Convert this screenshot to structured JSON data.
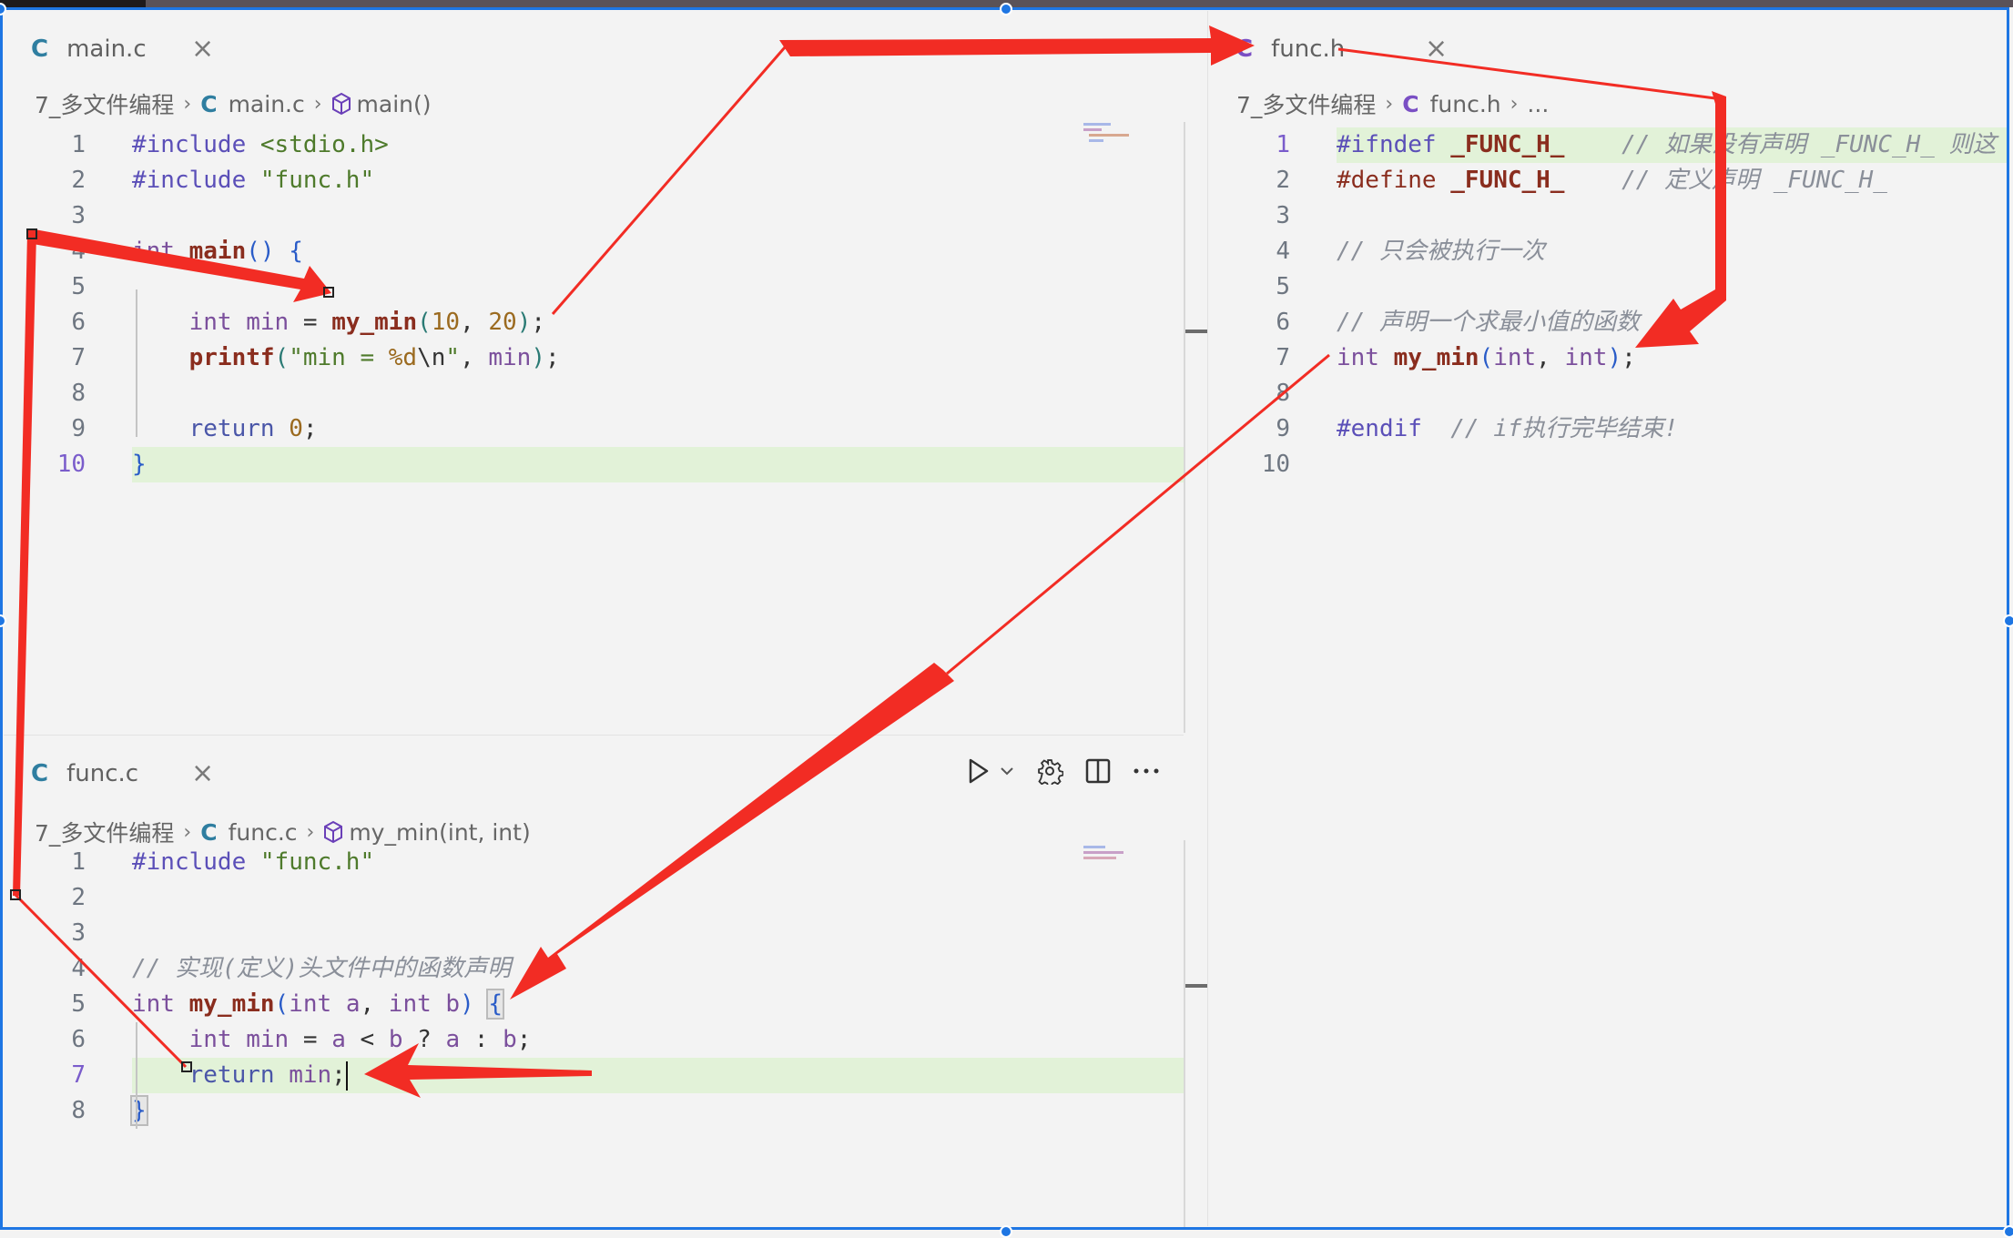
{
  "colors": {
    "accent": "#1e76e3",
    "annotation": "#f22c24",
    "c_icon_source": "#2f7ea0",
    "c_icon_header": "#7a4fc4",
    "line_highlight": "#e2f2d8"
  },
  "panes": {
    "main": {
      "tab": {
        "icon": "C",
        "label": "main.c",
        "close": "×"
      },
      "breadcrumb": {
        "folder": "7_多文件编程",
        "file_icon": "C",
        "file": "main.c",
        "symbol": "main()"
      },
      "lines": [
        {
          "n": "1",
          "text": "#include <stdio.h>"
        },
        {
          "n": "2",
          "text": "#include \"func.h\""
        },
        {
          "n": "3",
          "text": ""
        },
        {
          "n": "4",
          "text": "int main() {"
        },
        {
          "n": "5",
          "text": ""
        },
        {
          "n": "6",
          "text": "    int min = my_min(10, 20);"
        },
        {
          "n": "7",
          "text": "    printf(\"min = %d\\n\", min);"
        },
        {
          "n": "8",
          "text": ""
        },
        {
          "n": "9",
          "text": "    return 0;"
        },
        {
          "n": "10",
          "text": "}"
        }
      ],
      "active_line": "10"
    },
    "funcc": {
      "tab": {
        "icon": "C",
        "label": "func.c",
        "close": "×"
      },
      "breadcrumb": {
        "folder": "7_多文件编程",
        "file_icon": "C",
        "file": "func.c",
        "symbol": "my_min(int, int)"
      },
      "actions": [
        "run-icon",
        "run-dropdown-icon",
        "gear-icon",
        "split-editor-icon",
        "more-actions-icon"
      ],
      "lines": [
        {
          "n": "1",
          "text": "#include \"func.h\""
        },
        {
          "n": "2",
          "text": ""
        },
        {
          "n": "3",
          "text": ""
        },
        {
          "n": "4",
          "text": "// 实现(定义)头文件中的函数声明"
        },
        {
          "n": "5",
          "text": "int my_min(int a, int b) {"
        },
        {
          "n": "6",
          "text": "    int min = a < b ? a : b;"
        },
        {
          "n": "7",
          "text": "    return min;"
        },
        {
          "n": "8",
          "text": "}"
        }
      ],
      "active_line": "7"
    },
    "funch": {
      "tab": {
        "icon": "C",
        "label": "func.h",
        "close": "×"
      },
      "breadcrumb": {
        "folder": "7_多文件编程",
        "file_icon": "C",
        "file": "func.h",
        "symbol": "..."
      },
      "lines": [
        {
          "n": "1",
          "text": "#ifndef _FUNC_H_    // 如果没有声明 _FUNC_H_ 则这"
        },
        {
          "n": "2",
          "text": "#define _FUNC_H_    // 定义声明 _FUNC_H_"
        },
        {
          "n": "3",
          "text": ""
        },
        {
          "n": "4",
          "text": "// 只会被执行一次"
        },
        {
          "n": "5",
          "text": ""
        },
        {
          "n": "6",
          "text": "// 声明一个求最小值的函数"
        },
        {
          "n": "7",
          "text": "int my_min(int, int);"
        },
        {
          "n": "8",
          "text": ""
        },
        {
          "n": "9",
          "text": "#endif  // if执行完毕结束!"
        },
        {
          "n": "10",
          "text": ""
        }
      ],
      "active_line": "1"
    }
  },
  "tokens": {
    "main": {
      "l1": [
        [
          "#include",
          "pp"
        ],
        [
          " ",
          ""
        ],
        [
          "<stdio.h>",
          "str"
        ]
      ],
      "l2": [
        [
          "#include",
          "pp"
        ],
        [
          " ",
          ""
        ],
        [
          "\"func.h\"",
          "str"
        ]
      ],
      "l4": [
        [
          "int",
          "ty"
        ],
        [
          " ",
          ""
        ],
        [
          "main",
          "fn"
        ],
        [
          "()",
          "br"
        ],
        [
          " ",
          ""
        ],
        [
          "{",
          "br"
        ]
      ],
      "l6": [
        [
          "    ",
          ""
        ],
        [
          "int",
          "ty"
        ],
        [
          " ",
          ""
        ],
        [
          "min",
          "var"
        ],
        [
          " = ",
          "pn"
        ],
        [
          "my_min",
          "fn"
        ],
        [
          "(",
          "br2"
        ],
        [
          "10",
          "num"
        ],
        [
          ", ",
          "pn"
        ],
        [
          "20",
          "num"
        ],
        [
          ")",
          "br2"
        ],
        [
          ";",
          "pn"
        ]
      ],
      "l7": [
        [
          "    ",
          ""
        ],
        [
          "printf",
          "fn"
        ],
        [
          "(",
          "br2"
        ],
        [
          "\"min = ",
          "str"
        ],
        [
          "%d",
          "num"
        ],
        [
          "\\n",
          "pn"
        ],
        [
          "\"",
          "str"
        ],
        [
          ", ",
          "pn"
        ],
        [
          "min",
          "var"
        ],
        [
          ")",
          "br2"
        ],
        [
          ";",
          "pn"
        ]
      ],
      "l9": [
        [
          "    ",
          ""
        ],
        [
          "return",
          "kw"
        ],
        [
          " ",
          ""
        ],
        [
          "0",
          "num"
        ],
        [
          ";",
          "pn"
        ]
      ],
      "l10": [
        [
          "}",
          "br"
        ]
      ]
    },
    "funcc": {
      "l1": [
        [
          "#include",
          "pp"
        ],
        [
          " ",
          ""
        ],
        [
          "\"func.h\"",
          "str"
        ]
      ],
      "l4": [
        [
          "// 实现(定义)头文件中的函数声明",
          "cm"
        ]
      ],
      "l5": [
        [
          "int",
          "ty"
        ],
        [
          " ",
          ""
        ],
        [
          "my_min",
          "fn"
        ],
        [
          "(",
          "br"
        ],
        [
          "int",
          "ty"
        ],
        [
          " ",
          ""
        ],
        [
          "a",
          "var"
        ],
        [
          ", ",
          "pn"
        ],
        [
          "int",
          "ty"
        ],
        [
          " ",
          ""
        ],
        [
          "b",
          "var"
        ],
        [
          ")",
          "br"
        ],
        [
          " ",
          ""
        ],
        [
          "{",
          "brbox"
        ]
      ],
      "l6": [
        [
          "    ",
          ""
        ],
        [
          "int",
          "ty"
        ],
        [
          " ",
          ""
        ],
        [
          "min",
          "var"
        ],
        [
          " = ",
          "pn"
        ],
        [
          "a",
          "var"
        ],
        [
          " < ",
          "pn"
        ],
        [
          "b",
          "var"
        ],
        [
          " ? ",
          "pn"
        ],
        [
          "a",
          "var"
        ],
        [
          " : ",
          "pn"
        ],
        [
          "b",
          "var"
        ],
        [
          ";",
          "pn"
        ]
      ],
      "l7": [
        [
          "    ",
          ""
        ],
        [
          "return",
          "kw"
        ],
        [
          " ",
          ""
        ],
        [
          "min",
          "var"
        ],
        [
          ";",
          "pn"
        ],
        [
          "",
          "cursor"
        ]
      ],
      "l8": [
        [
          "}",
          "brbox"
        ]
      ]
    },
    "funch": {
      "l1": [
        [
          "#ifndef",
          "pp"
        ],
        [
          " ",
          ""
        ],
        [
          "_FUNC_H_",
          "mac"
        ],
        [
          "    ",
          ""
        ],
        [
          "// 如果没有声明 _FUNC_H_ 则这",
          "cm"
        ]
      ],
      "l2": [
        [
          "#define",
          "def"
        ],
        [
          " ",
          ""
        ],
        [
          "_FUNC_H_",
          "mac"
        ],
        [
          "    ",
          ""
        ],
        [
          "// 定义声明 _FUNC_H_",
          "cm"
        ]
      ],
      "l4": [
        [
          "// 只会被执行一次",
          "cm"
        ]
      ],
      "l6": [
        [
          "// 声明一个求最小值的函数",
          "cm"
        ]
      ],
      "l7": [
        [
          "int",
          "ty"
        ],
        [
          " ",
          ""
        ],
        [
          "my_min",
          "fn"
        ],
        [
          "(",
          "br"
        ],
        [
          "int",
          "ty"
        ],
        [
          ", ",
          "pn"
        ],
        [
          "int",
          "ty"
        ],
        [
          ")",
          "br"
        ],
        [
          ";",
          "pn"
        ]
      ],
      "l9": [
        [
          "#endif",
          "pp"
        ],
        [
          "  ",
          ""
        ],
        [
          "// if执行完毕结束!",
          "cm"
        ]
      ]
    }
  },
  "annotations": [
    {
      "name": "arrow-main-line4-to-line6",
      "kind": "thick-arrow",
      "from": "main.c line 4",
      "to": "main.c line 6 my_min call"
    },
    {
      "name": "arrow-call-to-funch-tab",
      "kind": "thick-arrow",
      "from": "main.c line 6 my_min call",
      "to": "func.h tab"
    },
    {
      "name": "arrow-funch-tab-to-declaration",
      "kind": "thick-arrow",
      "from": "func.h tab",
      "to": "func.h line 7 declaration"
    },
    {
      "name": "arrow-declaration-to-definition",
      "kind": "thick-arrow",
      "from": "func.h line 7 declaration",
      "to": "func.c line 5 definition"
    },
    {
      "name": "arrow-main-line4-to-funcc",
      "kind": "thin-line",
      "from": "main.c line 4",
      "to": "func.c line 7 return"
    },
    {
      "name": "arrow-return-pointer",
      "kind": "thick-arrow",
      "from": "right",
      "to": "func.c line 7 return min;"
    }
  ]
}
